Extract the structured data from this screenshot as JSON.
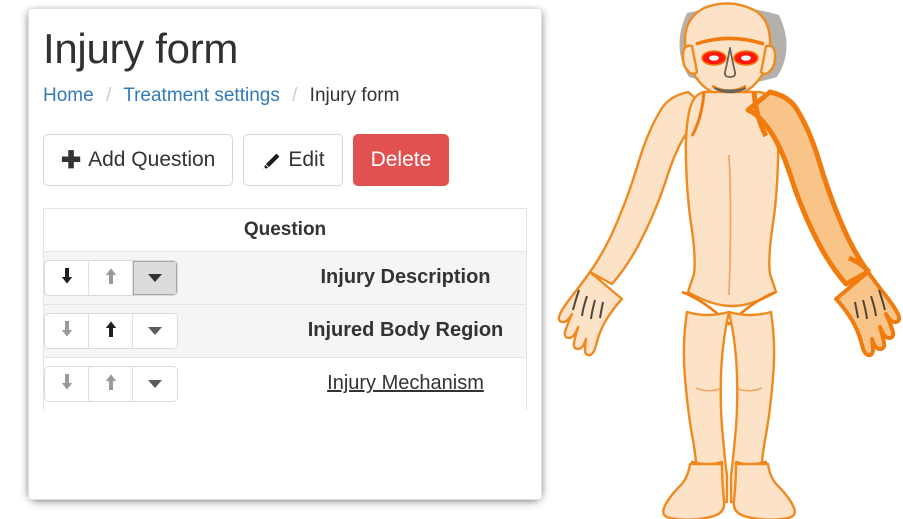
{
  "page": {
    "title": "Injury form"
  },
  "breadcrumb": {
    "separator": "/",
    "items": [
      {
        "label": "Home",
        "type": "link"
      },
      {
        "label": "Treatment settings",
        "type": "link"
      },
      {
        "label": "Injury form",
        "type": "active"
      }
    ]
  },
  "toolbar": {
    "add_label": "Add Question",
    "add_icon": "plus-icon",
    "edit_label": "Edit",
    "edit_icon": "pencil-icon",
    "delete_label": "Delete",
    "colors": {
      "danger": "#e05150",
      "link": "#337ab7",
      "text": "#333333"
    }
  },
  "table": {
    "columns": [
      "",
      "Question"
    ],
    "header_label": "Question",
    "rows": [
      {
        "label": "Injury Description",
        "style": "bold",
        "striped": true,
        "controls": {
          "move_down": {
            "icon": "arrow-down-icon",
            "state": "active"
          },
          "move_up": {
            "icon": "arrow-up-icon",
            "state": "dim"
          },
          "menu": {
            "icon": "caret-down-icon",
            "state": "pressed"
          }
        }
      },
      {
        "label": "Injured Body Region",
        "style": "bold",
        "striped": true,
        "controls": {
          "move_down": {
            "icon": "arrow-down-icon",
            "state": "dim"
          },
          "move_up": {
            "icon": "arrow-up-icon",
            "state": "active"
          },
          "menu": {
            "icon": "caret-down-icon",
            "state": "normal"
          }
        }
      },
      {
        "label": "Injury Mechanism",
        "style": "link",
        "striped": false,
        "controls": {
          "move_down": {
            "icon": "arrow-down-icon",
            "state": "dim"
          },
          "move_up": {
            "icon": "arrow-up-icon",
            "state": "dim"
          },
          "menu": {
            "icon": "caret-down-icon",
            "state": "normal"
          }
        }
      }
    ]
  },
  "body_diagram": {
    "name": "human-body-front-view",
    "selected_regions": [
      "right-arm",
      "eyes"
    ],
    "colors": {
      "skin_fill": "#fce3c8",
      "highlight_fill": "#f9c487",
      "outline": "#f07c10",
      "outline_thin": "#e8873a",
      "eye_highlight": "#fc1707",
      "shadow": "#5a5248"
    }
  }
}
